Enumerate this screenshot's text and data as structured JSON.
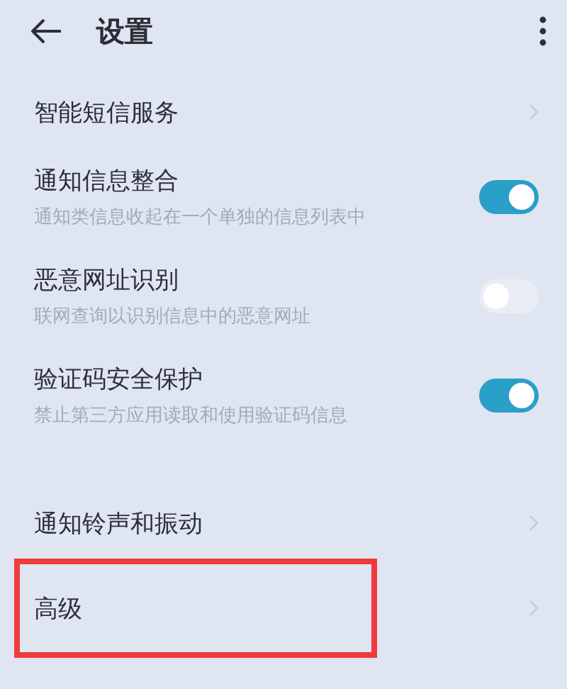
{
  "header": {
    "title": "设置"
  },
  "items": [
    {
      "kind": "link",
      "title": "智能短信服务",
      "highlighted": false
    },
    {
      "kind": "toggle",
      "title": "通知信息整合",
      "subtitle": "通知类信息收起在一个单独的信息列表中",
      "on": true,
      "highlighted": false
    },
    {
      "kind": "toggle",
      "title": "恶意网址识别",
      "subtitle": "联网查询以识别信息中的恶意网址",
      "on": false,
      "highlighted": false
    },
    {
      "kind": "toggle",
      "title": "验证码安全保护",
      "subtitle": "禁止第三方应用读取和使用验证码信息",
      "on": true,
      "highlighted": false
    },
    {
      "kind": "link",
      "title": "通知铃声和振动",
      "highlighted": false
    },
    {
      "kind": "link",
      "title": "高级",
      "highlighted": true
    }
  ]
}
